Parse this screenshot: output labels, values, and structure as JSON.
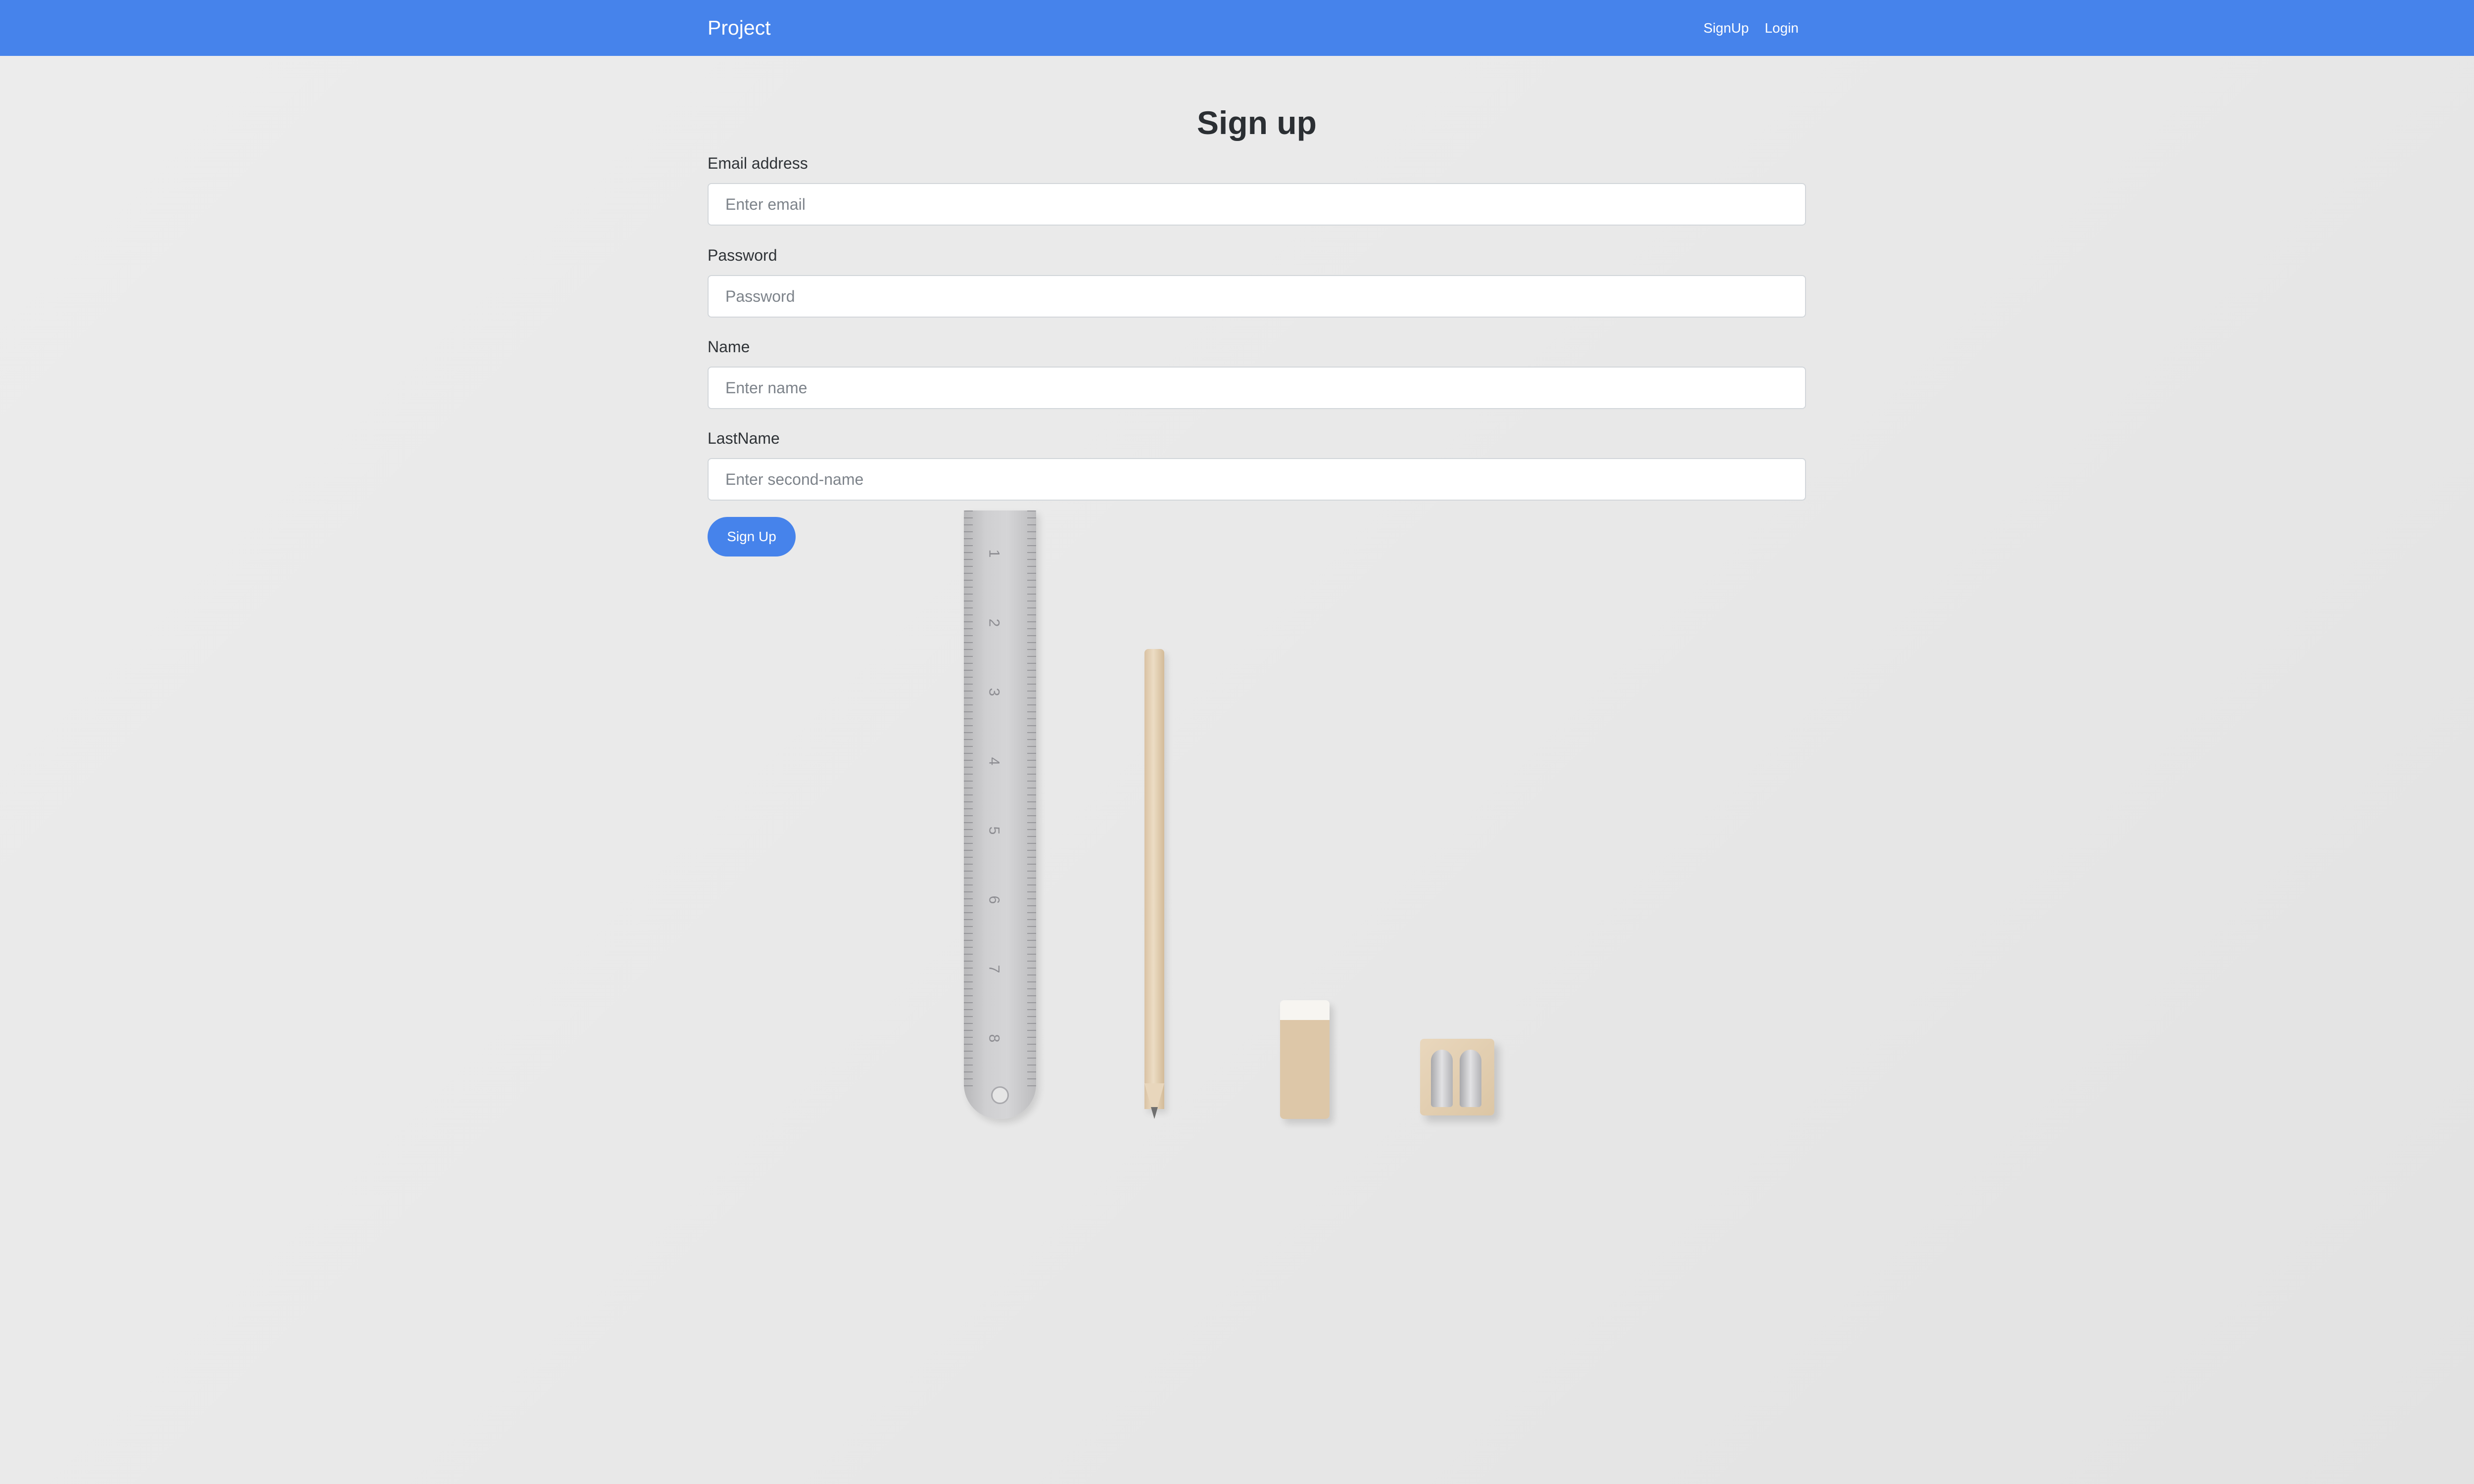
{
  "navbar": {
    "brand": "Project",
    "links": [
      {
        "label": "SignUp"
      },
      {
        "label": "Login"
      }
    ],
    "background_color": "#4683eb"
  },
  "form": {
    "title": "Sign up",
    "fields": [
      {
        "label": "Email address",
        "placeholder": "Enter email",
        "type": "email"
      },
      {
        "label": "Password",
        "placeholder": "Password",
        "type": "password"
      },
      {
        "label": "Name",
        "placeholder": "Enter name",
        "type": "text"
      },
      {
        "label": "LastName",
        "placeholder": "Enter second-name",
        "type": "text"
      }
    ],
    "submit_label": "Sign Up",
    "accent_color": "#4683eb"
  },
  "decoration": {
    "ruler_numbers": [
      "1",
      "2",
      "3",
      "4",
      "5",
      "6",
      "7",
      "8"
    ],
    "objects": [
      "ruler-icon",
      "pencil-icon",
      "eraser-icon",
      "sharpener-icon"
    ]
  }
}
